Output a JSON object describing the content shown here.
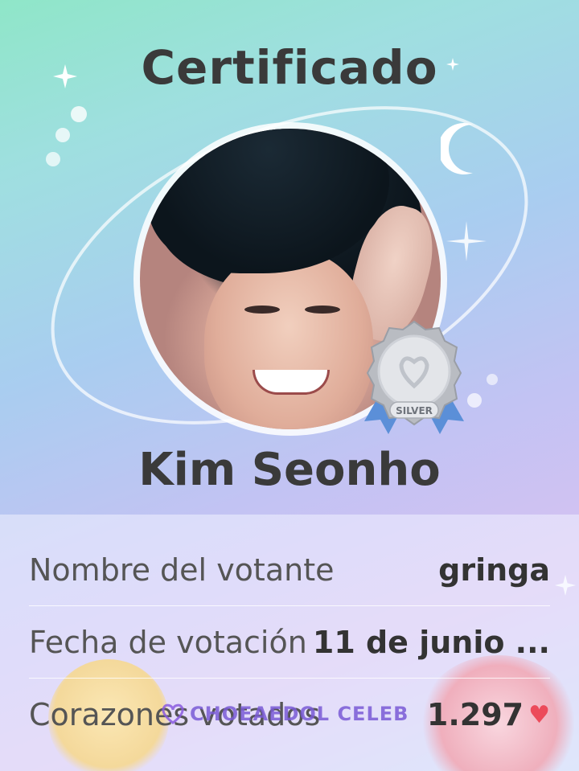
{
  "certificate": {
    "title": "Certificado",
    "artist_name": "Kim Seonho",
    "badge_text": "SILVER"
  },
  "details": [
    {
      "label": "Nombre del votante",
      "value": "gringa"
    },
    {
      "label": "Fecha de votación",
      "value": "11 de junio ..."
    },
    {
      "label": "Corazones votados",
      "value": "1.297"
    }
  ],
  "watermark": "CHOEAEDOL CELEB",
  "colors": {
    "text_dark": "#3a3a3a",
    "heart": "#ec4a5a",
    "watermark": "#7a5bd6"
  },
  "icons": [
    "sparkle-icon",
    "moon-icon",
    "silver-medal-icon",
    "heart-icon"
  ]
}
